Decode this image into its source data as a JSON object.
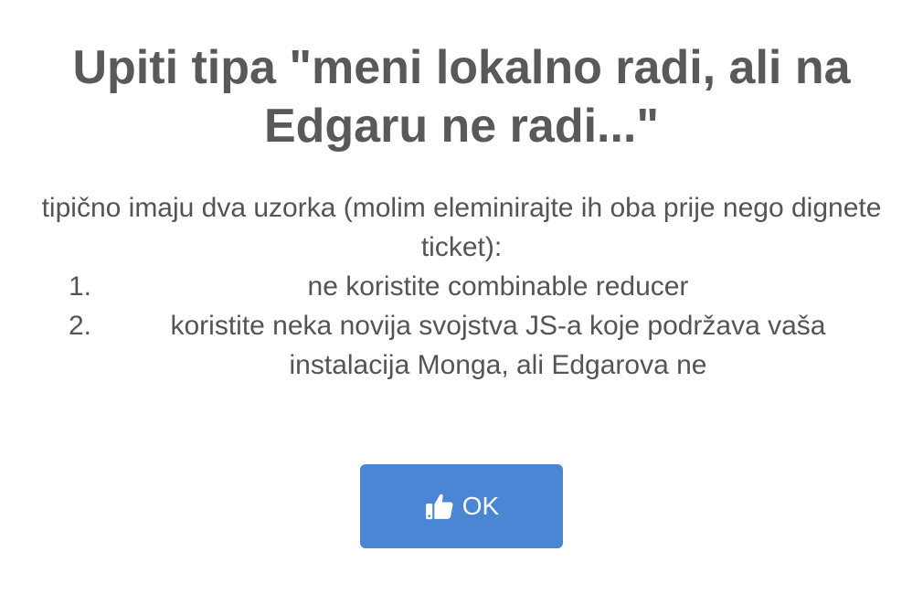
{
  "dialog": {
    "title": "Upiti tipa \"meni lokalno radi, ali na Edgaru ne radi...\"",
    "intro": "tipično imaju dva uzorka (molim eleminirajte ih oba prije nego dignete ticket):",
    "steps": [
      {
        "number": "1.",
        "text": "ne koristite combinable reducer"
      },
      {
        "number": "2.",
        "text": "koristite neka novija svojstva JS-a koje podržava vaša instalacija Monga, ali Edgarova ne"
      }
    ],
    "ok_button": {
      "icon": "thumbs-up-icon",
      "label": "OK",
      "color": "#4a86d4"
    }
  }
}
